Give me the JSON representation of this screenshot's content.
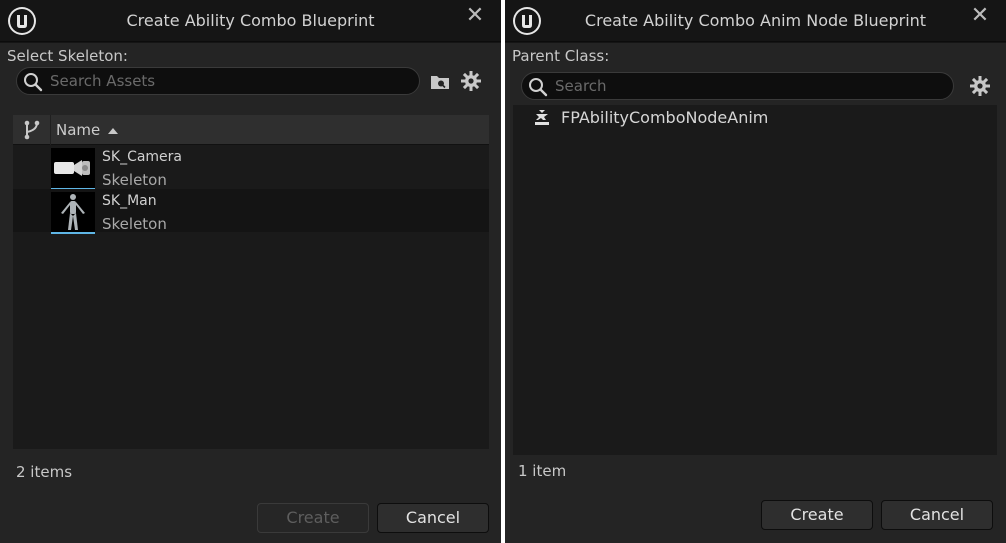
{
  "dialog_left": {
    "title": "Create Ability Combo Blueprint",
    "close_glyph": "✕",
    "section_label": "Select Skeleton:",
    "search": {
      "placeholder": "Search Assets",
      "value": ""
    },
    "icons": {
      "logo": "unreal-logo-icon",
      "search": "search-icon",
      "folder": "folder-icon",
      "settings": "gear-icon",
      "source_control": "source-control-branch-icon",
      "sort": "sort-ascending-icon"
    },
    "columns": {
      "name": "Name"
    },
    "assets": [
      {
        "name": "SK_Camera",
        "type": "Skeleton",
        "thumbnail": "camera-thumbnail"
      },
      {
        "name": "SK_Man",
        "type": "Skeleton",
        "thumbnail": "mannequin-thumbnail"
      }
    ],
    "item_count": "2 items",
    "buttons": {
      "create": "Create",
      "cancel": "Cancel"
    },
    "create_enabled": false
  },
  "dialog_right": {
    "title": "Create Ability Combo Anim Node Blueprint",
    "close_glyph": "✕",
    "section_label": "Parent Class:",
    "search": {
      "placeholder": "Search",
      "value": ""
    },
    "icons": {
      "logo": "unreal-logo-icon",
      "search": "search-icon",
      "settings": "gear-icon",
      "class": "anim-node-class-icon"
    },
    "classes": [
      {
        "name": "FPAbilityComboNodeAnim"
      }
    ],
    "item_count": "1 item",
    "buttons": {
      "create": "Create",
      "cancel": "Cancel"
    },
    "create_enabled": true
  },
  "colors": {
    "title_bar": "#151515",
    "panel_bg": "#242424",
    "list_bg": "#1a1a1a",
    "selection_accent": "#5fb6e6",
    "text": "#c8c8c8"
  }
}
